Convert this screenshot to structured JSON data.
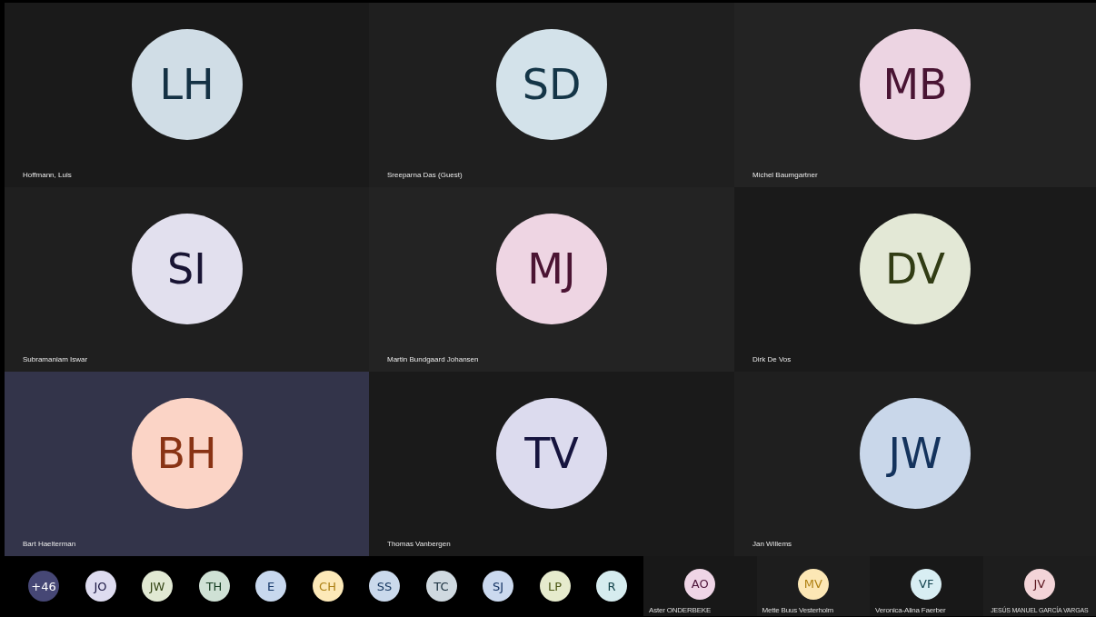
{
  "tiles": [
    {
      "initials": "LH",
      "name": "Hoffmann, Luis",
      "color": "#d0dde6",
      "selected": false
    },
    {
      "initials": "SD",
      "name": "Sreeparna Das (Guest)",
      "color": "#d3e2ea",
      "selected": false
    },
    {
      "initials": "MB",
      "name": "Michel Baumgartner",
      "color": "#ecd4e2",
      "selected": false
    },
    {
      "initials": "SI",
      "name": "Subramaniam Iswar",
      "color": "#e2e0ee",
      "selected": false
    },
    {
      "initials": "MJ",
      "name": "Martin Bundgaard Johansen",
      "color": "#eed5e3",
      "selected": false
    },
    {
      "initials": "DV",
      "name": "Dirk De Vos",
      "color": "#e3e8d6",
      "selected": false
    },
    {
      "initials": "BH",
      "name": "Bart Haelterman",
      "color": "#fbd4c6",
      "selected": true
    },
    {
      "initials": "TV",
      "name": "Thomas Vanbergen",
      "color": "#dcdbee",
      "selected": false
    },
    {
      "initials": "JW",
      "name": "Jan Willems",
      "color": "#c9d7ea",
      "selected": false
    }
  ],
  "overflow_avatars": [
    {
      "initials": "+46",
      "color": "#464775"
    },
    {
      "initials": "JO",
      "color": "#dedcf0"
    },
    {
      "initials": "JW",
      "color": "#e1e9d3"
    },
    {
      "initials": "TH",
      "color": "#cfe1d5"
    },
    {
      "initials": "E",
      "color": "#c8d8ee"
    },
    {
      "initials": "CH",
      "color": "#fde9b8"
    },
    {
      "initials": "SS",
      "color": "#cad9ec"
    },
    {
      "initials": "TC",
      "color": "#cfd9e0"
    },
    {
      "initials": "SJ",
      "color": "#cbd9ef"
    },
    {
      "initials": "LP",
      "color": "#e6ebcd"
    },
    {
      "initials": "R",
      "color": "#d6ecef"
    }
  ],
  "small_tiles": [
    {
      "initials": "AO",
      "name": "Aster ONDERBEKE",
      "color": "#efd5e6"
    },
    {
      "initials": "MV",
      "name": "Mette Buus Vesterholm",
      "color": "#fce7b5"
    },
    {
      "initials": "VF",
      "name": "Veronica-Alina Faerber",
      "color": "#d8eef3"
    },
    {
      "initials": "JV",
      "name": "JESÚS MANUEL GARCÍA VARGAS",
      "color": "#f3d4d8"
    }
  ]
}
